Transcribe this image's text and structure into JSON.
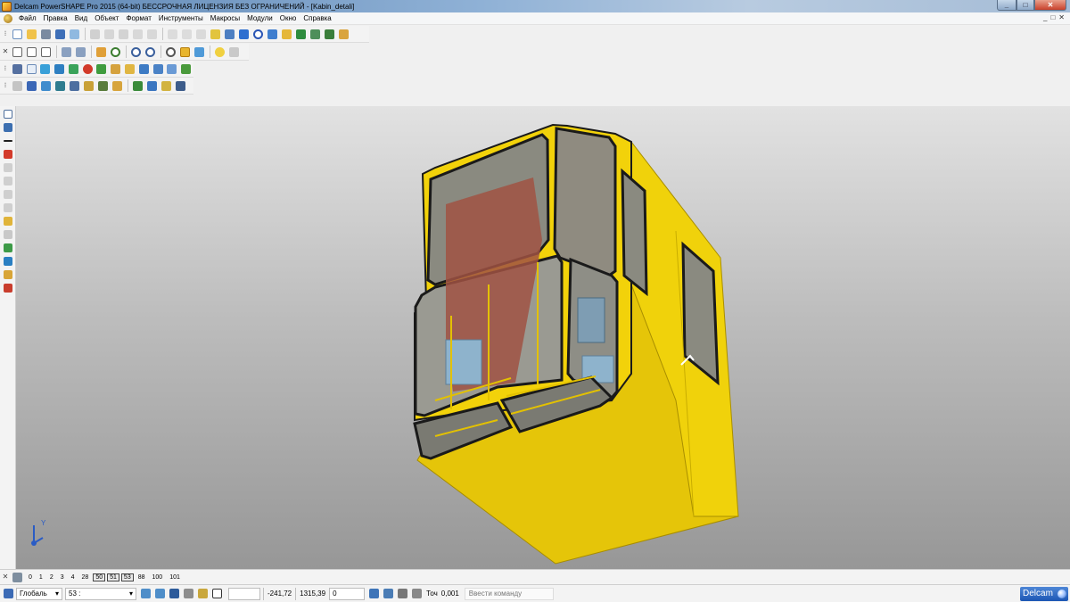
{
  "window": {
    "title": "Delcam PowerSHAPE Pro 2015 (64-bit) БЕССРОЧНАЯ ЛИЦЕНЗИЯ БЕЗ ОГРАНИЧЕНИЙ - [Kabin_detali]"
  },
  "menu": [
    "Файл",
    "Правка",
    "Вид",
    "Объект",
    "Формат",
    "Инструменты",
    "Макросы",
    "Модули",
    "Окно",
    "Справка"
  ],
  "levels": [
    "0",
    "1",
    "2",
    "3",
    "4",
    "28",
    "50",
    "51",
    "53",
    "88",
    "100",
    "101"
  ],
  "levels_boxed": [
    "50",
    "51",
    "53"
  ],
  "status": {
    "workplane": "Глобаль",
    "level": "53 :",
    "coord_x": "-241,72",
    "coord_y": "1315,39",
    "coord_z": "0",
    "tolerance_label": "Точ",
    "tolerance_value": "0,001",
    "command_placeholder": "Ввести команду",
    "logo": "Delcam"
  },
  "axis": {
    "y": "Y"
  },
  "colors": {
    "cabin_yellow": "#f2d20a",
    "frame": "#1a1a1a",
    "glass": "#8f8f86",
    "interior_red": "#a05243",
    "seat_blue": "#8eb3cc"
  }
}
